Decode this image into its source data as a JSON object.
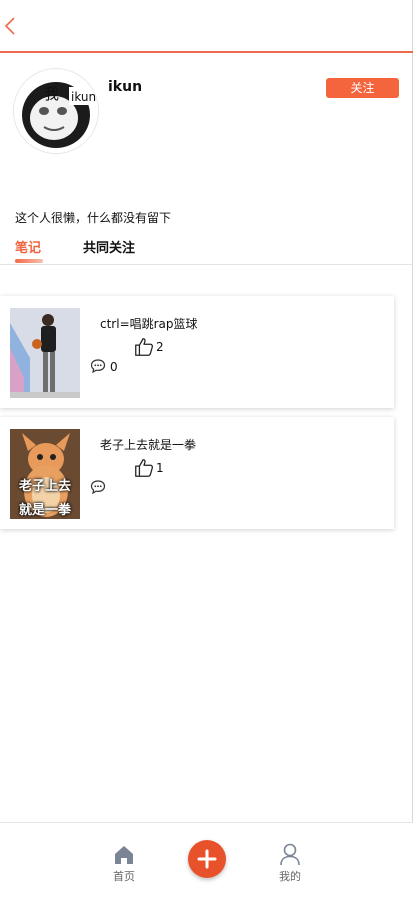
{
  "header": {
    "back_icon": "chevron-left-icon"
  },
  "profile": {
    "username": "ikun",
    "avatar_text": "我",
    "avatar_text_2": "ikun",
    "follow_label": "关注",
    "bio": "这个人很懒，什么都没有留下"
  },
  "tabs": [
    {
      "label": "笔记",
      "active": true
    },
    {
      "label": "共同关注",
      "active": false
    }
  ],
  "notes": [
    {
      "title": "ctrl=唱跳rap篮球",
      "likes": "2",
      "comments": "0"
    },
    {
      "title": "老子上去就是一拳",
      "likes": "1",
      "comments": "",
      "thumb_text_1": "老子上去",
      "thumb_text_2": "就是一拳"
    }
  ],
  "bottom_nav": {
    "home_label": "首页",
    "me_label": "我的",
    "add_icon": "plus-icon"
  },
  "colors": {
    "accent": "#f4643d",
    "header_line": "#ee6a4a",
    "add_button": "#e8522b"
  }
}
